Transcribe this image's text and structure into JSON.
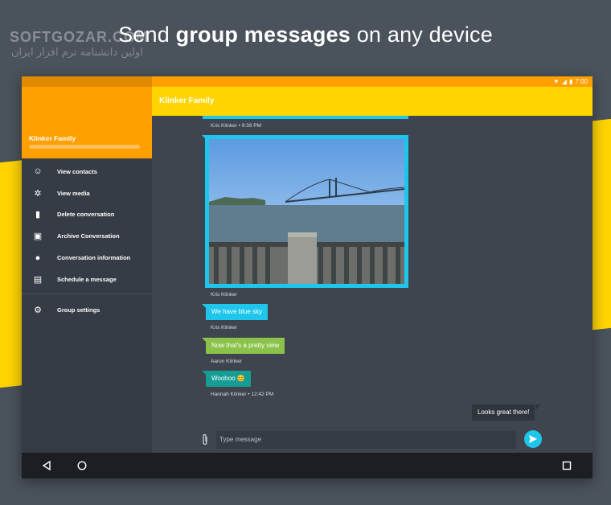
{
  "banner": {
    "headline_pre": "Send ",
    "headline_bold": "group messages",
    "headline_post": " on any device",
    "watermark": "SOFTGOZAR.COM",
    "watermark_sub": "اولین دانشنامه نرم افزار ایران"
  },
  "status_bar": {
    "time": "7:00"
  },
  "toolbar": {
    "title": "Klinker Family"
  },
  "drawer": {
    "name": "Klinker Family",
    "items": [
      {
        "label": "View contacts",
        "icon": "face-icon"
      },
      {
        "label": "View media",
        "icon": "aperture-icon"
      },
      {
        "label": "Delete conversation",
        "icon": "trash-icon"
      },
      {
        "label": "Archive Conversation",
        "icon": "archive-icon"
      },
      {
        "label": "Conversation information",
        "icon": "info-icon"
      },
      {
        "label": "Schedule a message",
        "icon": "calendar-icon"
      }
    ],
    "settings": {
      "label": "Group settings",
      "icon": "gear-icon"
    }
  },
  "messages": {
    "first_meta": "Kris Klinker • 9:39 PM",
    "photo_meta": "Kris Klinker",
    "m1": {
      "text": "We have blue sky",
      "meta": "Kris Klinker"
    },
    "m2": {
      "text": "Now that's a pretty view",
      "meta": "Aaron Klinker"
    },
    "m3": {
      "text": "Woohoo 😊",
      "meta": "Hannah Klinker • 12:42 PM"
    },
    "outgoing": {
      "text": "Looks great there!"
    }
  },
  "composer": {
    "placeholder": "Type message"
  },
  "colors": {
    "accent_orange": "#ff9f00",
    "accent_yellow": "#ffd400",
    "bubble_blue": "#1ec6ec",
    "bubble_green": "#8bc34a",
    "bubble_teal": "#159d94"
  }
}
